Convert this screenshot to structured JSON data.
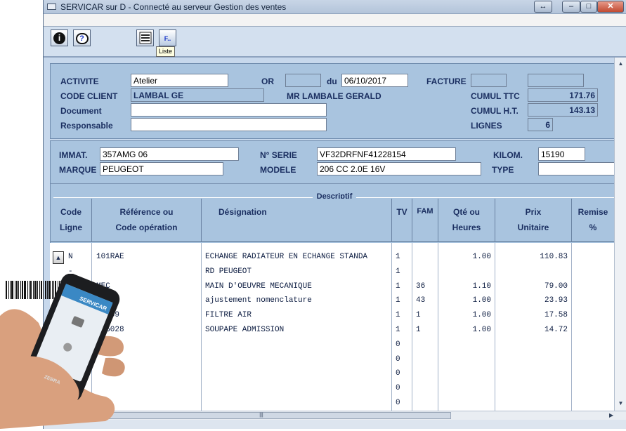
{
  "window": {
    "title": "SERVICAR sur D - Connecté au serveur Gestion des ventes"
  },
  "toolbar": {
    "tooltip": "Liste",
    "info_icon": "info-icon",
    "help_icon": "help-icon",
    "list_icon": "list-icon",
    "fkey_icon": "function-key-icon",
    "fkey_label": "F.."
  },
  "header": {
    "activite_label": "ACTIVITE",
    "activite_value": "Atelier",
    "or_label": "OR",
    "or_value": "",
    "du_label": "du",
    "du_value": "06/10/2017",
    "facture_label": "FACTURE",
    "facture_value": "",
    "facture_value2": "",
    "code_client_label": "CODE CLIENT",
    "code_client_value": "LAMBAL GE",
    "client_name": "MR LAMBALE GERALD",
    "cumul_ttc_label": "CUMUL TTC",
    "cumul_ttc_value": "171.76",
    "document_label": "Document",
    "document_value": "",
    "cumul_ht_label": "CUMUL H.T.",
    "cumul_ht_value": "143.13",
    "responsable_label": "Responsable",
    "responsable_value": "",
    "lignes_label": "LIGNES",
    "lignes_value": "6"
  },
  "vehicle": {
    "immat_label": "IMMAT.",
    "immat_value": "357AMG 06",
    "serie_label": "N° SERIE",
    "serie_value": "VF32DRFNF41228154",
    "kilom_label": "KILOM.",
    "kilom_value": "15190",
    "marque_label": "MARQUE",
    "marque_value": "PEUGEOT",
    "modele_label": "MODELE",
    "modele_value": "206 CC 2.0E 16V",
    "type_label": "TYPE",
    "type_value": ""
  },
  "grid": {
    "section_title": "Descriptif",
    "columns": [
      {
        "l1": "Code",
        "l2": "Ligne"
      },
      {
        "l1": "Référence ou",
        "l2": "Code opération"
      },
      {
        "l1": "Désignation",
        "l2": ""
      },
      {
        "l1": "TV",
        "l2": ""
      },
      {
        "l1": "FAM",
        "l2": ""
      },
      {
        "l1": "Qté ou",
        "l2": "Heures"
      },
      {
        "l1": "Prix",
        "l2": "Unitaire"
      },
      {
        "l1": "Remise",
        "l2": "%"
      }
    ],
    "rows": [
      {
        "code": "N",
        "ref": "101RAE",
        "des": "ECHANGE RADIATEUR EN ECHANGE STANDA",
        "tv": "1",
        "fam": "",
        "qte": "1.00",
        "prix": "110.83"
      },
      {
        "code": "-",
        "ref": "",
        "des": "RD PEUGEOT",
        "tv": "1",
        "fam": "",
        "qte": "",
        "prix": ""
      },
      {
        "code": "",
        "ref": "MEC",
        "des": "MAIN D'OEUVRE MECANIQUE",
        "tv": "1",
        "fam": "36",
        "qte": "1.10",
        "prix": "79.00"
      },
      {
        "code": "",
        "ref": "",
        "des": "ajustement nomenclature",
        "tv": "1",
        "fam": "43",
        "qte": "1.00",
        "prix": "23.93"
      },
      {
        "code": "",
        "ref": "83269",
        "des": "FILTRE AIR",
        "tv": "1",
        "fam": "1",
        "qte": "1.00",
        "prix": "17.58"
      },
      {
        "code": "",
        "ref": "185028",
        "des": "SOUPAPE ADMISSION",
        "tv": "1",
        "fam": "1",
        "qte": "1.00",
        "prix": "14.72"
      },
      {
        "code": "",
        "ref": "",
        "des": "",
        "tv": "0",
        "fam": "",
        "qte": "",
        "prix": ""
      },
      {
        "code": "",
        "ref": "",
        "des": "",
        "tv": "0",
        "fam": "",
        "qte": "",
        "prix": ""
      },
      {
        "code": "",
        "ref": "",
        "des": "",
        "tv": "0",
        "fam": "",
        "qte": "",
        "prix": ""
      },
      {
        "code": "",
        "ref": "",
        "des": "",
        "tv": "0",
        "fam": "",
        "qte": "",
        "prix": ""
      },
      {
        "code": "",
        "ref": "",
        "des": "",
        "tv": "0",
        "fam": "",
        "qte": "",
        "prix": ""
      }
    ]
  },
  "phone": {
    "brand": "SERVICAR",
    "maker": "ZEBRA"
  },
  "colors": {
    "panel": "#a9c4df",
    "label": "#1b2f61",
    "window": "#c7d8ec"
  }
}
